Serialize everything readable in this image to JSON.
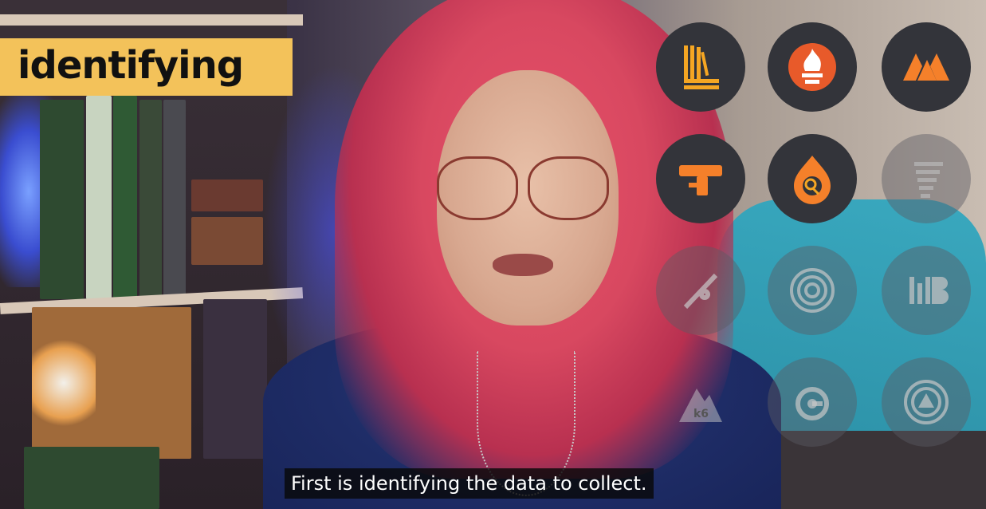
{
  "overlay": {
    "banner_text": "identifying",
    "caption": "First is identifying the data to collect."
  },
  "icons": [
    {
      "name": "loki-icon",
      "faded": false
    },
    {
      "name": "prometheus-icon",
      "faded": false
    },
    {
      "name": "mimir-icon",
      "faded": false
    },
    {
      "name": "pyroscope-icon",
      "faded": false
    },
    {
      "name": "beyla-icon",
      "faded": false
    },
    {
      "name": "faro-icon",
      "faded": true
    },
    {
      "name": "alloy-telescope-icon",
      "faded": true
    },
    {
      "name": "tempo-spiral-icon",
      "faded": true
    },
    {
      "name": "mb-logo-icon",
      "faded": true
    },
    {
      "name": "k6-icon",
      "faded": true
    },
    {
      "name": "grafana-icon",
      "faded": true
    },
    {
      "name": "onCall-icon",
      "faded": true
    }
  ],
  "k6_label": "k6",
  "colors": {
    "banner": "#f3c25a",
    "icon_bg": "#33343a",
    "icon_orange": "#f5a623",
    "icon_red": "#e85a2a",
    "caption_bg": "#080808"
  }
}
